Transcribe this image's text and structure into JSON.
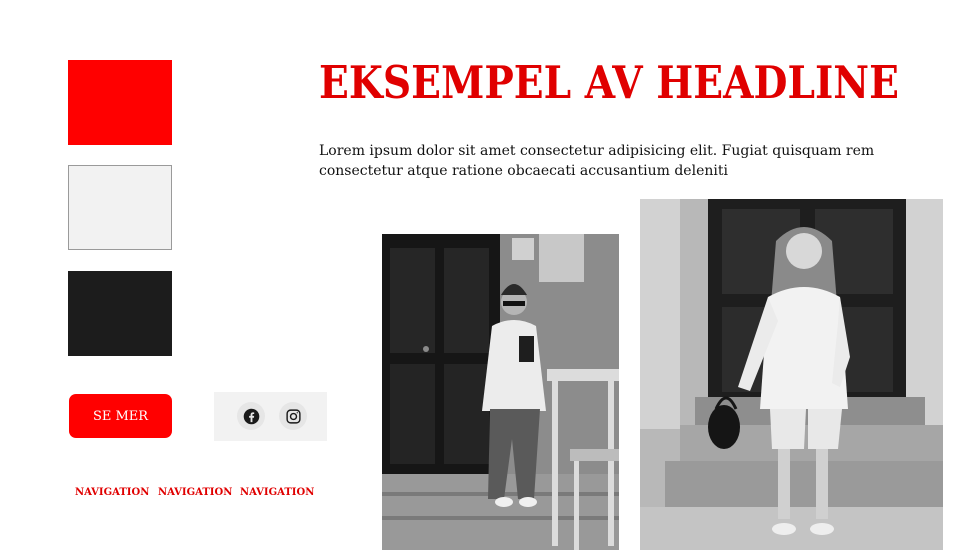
{
  "palette": {
    "swatches": [
      {
        "name": "red",
        "color": "#ff0000"
      },
      {
        "name": "light-gray",
        "color": "#f2f2f2"
      },
      {
        "name": "black",
        "color": "#1c1c1c"
      }
    ]
  },
  "cta": {
    "label": "SE MER"
  },
  "social": {
    "icons": [
      "facebook-icon",
      "instagram-icon"
    ]
  },
  "navigation": {
    "items": [
      "NAVIGATION",
      "NAVIGATION",
      "NAVIGATION"
    ]
  },
  "hero": {
    "headline": "EKSEMPEL AV HEADLINE",
    "body": "Lorem ipsum dolor sit amet consectetur adipisicing elit. Fugiat quisquam rem consectetur atque ratione obcaecati accusantium deleniti"
  },
  "colors": {
    "accent": "#ff0000",
    "headline": "#e00000",
    "text": "#111111"
  }
}
